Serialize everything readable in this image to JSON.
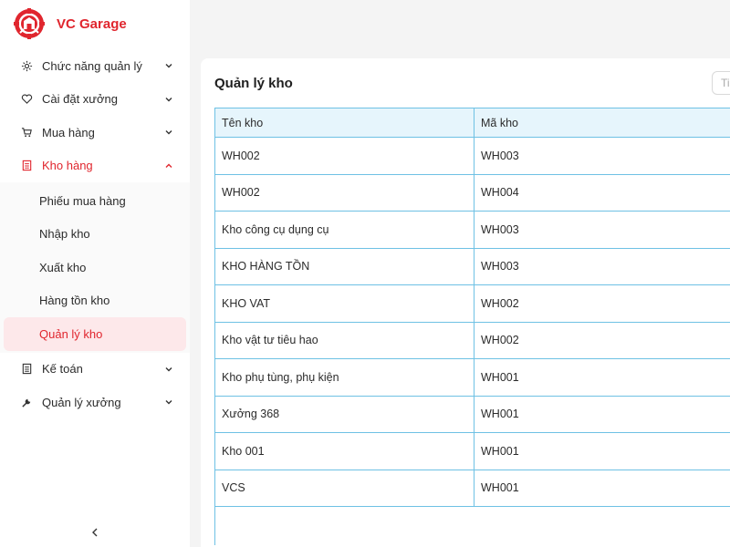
{
  "brand": {
    "name": "VC Garage",
    "color": "#e0262e"
  },
  "sidebar": {
    "items": [
      {
        "label": "Chức năng quản lý",
        "icon": "gear-icon"
      },
      {
        "label": "Cài đặt xưởng",
        "icon": "heart-icon"
      },
      {
        "label": "Mua hàng",
        "icon": "cart-icon"
      },
      {
        "label": "Kho hàng",
        "icon": "warehouse-list-icon",
        "expanded": true
      },
      {
        "label": "Kế toán",
        "icon": "accounting-list-icon"
      },
      {
        "label": "Quản lý xưởng",
        "icon": "wrench-icon"
      }
    ],
    "submenu": [
      {
        "label": "Phiếu mua hàng"
      },
      {
        "label": "Nhập kho"
      },
      {
        "label": "Xuất kho"
      },
      {
        "label": "Hàng tồn kho"
      },
      {
        "label": "Quản lý kho",
        "selected": true
      }
    ],
    "collapse_icon": "chevron-left-icon"
  },
  "main": {
    "title": "Quản lý kho",
    "search_placeholder": "Ti"
  },
  "table": {
    "columns": [
      "Tên kho",
      "Mã kho"
    ],
    "rows": [
      [
        "WH002",
        "WH003"
      ],
      [
        "WH002",
        "WH004"
      ],
      [
        "Kho công cụ dụng cụ",
        "WH003"
      ],
      [
        "KHO HÀNG TỒN",
        "WH003"
      ],
      [
        "KHO VAT",
        "WH002"
      ],
      [
        "Kho vật tư tiêu hao",
        "WH002"
      ],
      [
        "Kho phụ tùng, phụ kiện",
        "WH001"
      ],
      [
        "Xưởng 368",
        "WH001"
      ],
      [
        "Kho 001",
        "WH001"
      ],
      [
        "VCS",
        "WH001"
      ]
    ],
    "border_color": "#6ec1e4",
    "header_bg": "#e6f5fc"
  }
}
